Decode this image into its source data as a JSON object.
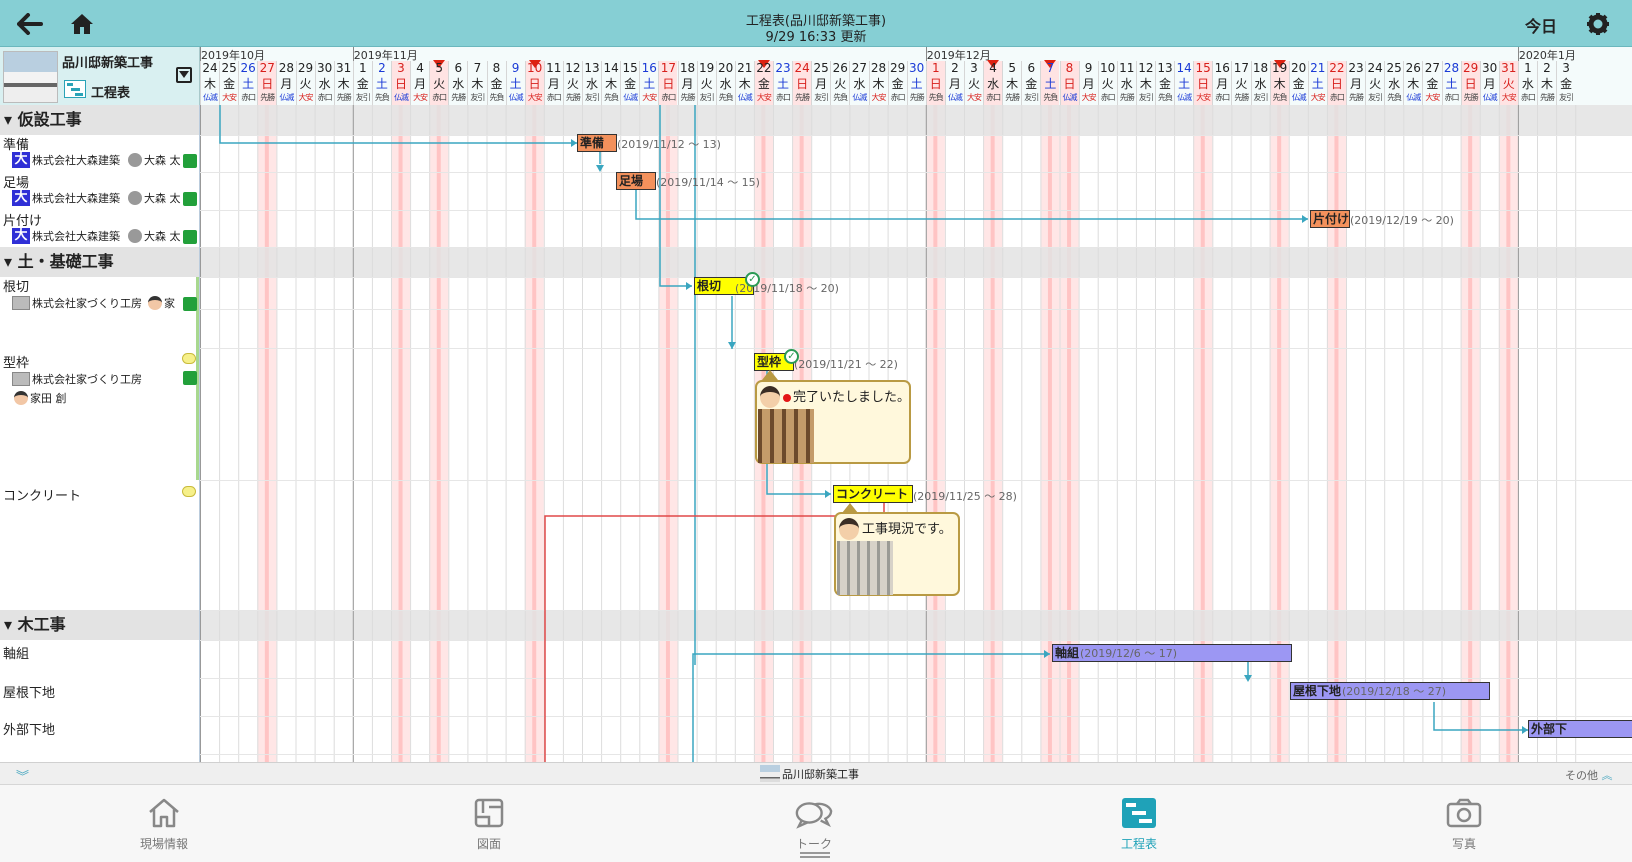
{
  "header": {
    "title": "工程表(品川邸新築工事)",
    "updated": "9/29 16:33 更新",
    "today_label": "今日"
  },
  "project": {
    "name": "品川邸新築工事",
    "sub_label": "工程表"
  },
  "months": [
    {
      "label": "2019年10月",
      "start": 0
    },
    {
      "label": "2019年11月",
      "start": 8
    },
    {
      "label": "2019年12月",
      "start": 38
    },
    {
      "label": "2020年1月",
      "start": 69
    }
  ],
  "days": [
    {
      "d": "24",
      "w": "木",
      "r": "仏滅",
      "c": "k"
    },
    {
      "d": "25",
      "w": "金",
      "r": "大安",
      "c": "k"
    },
    {
      "d": "26",
      "w": "土",
      "r": "赤口",
      "c": "b"
    },
    {
      "d": "27",
      "w": "日",
      "r": "先勝",
      "c": "r"
    },
    {
      "d": "28",
      "w": "月",
      "r": "仏滅",
      "c": "k"
    },
    {
      "d": "29",
      "w": "火",
      "r": "大安",
      "c": "k"
    },
    {
      "d": "30",
      "w": "水",
      "r": "赤口",
      "c": "k"
    },
    {
      "d": "31",
      "w": "木",
      "r": "先勝",
      "c": "k"
    },
    {
      "d": "1",
      "w": "金",
      "r": "友引",
      "c": "k"
    },
    {
      "d": "2",
      "w": "土",
      "r": "先負",
      "c": "b"
    },
    {
      "d": "3",
      "w": "日",
      "r": "仏滅",
      "c": "r"
    },
    {
      "d": "4",
      "w": "月",
      "r": "大安",
      "c": "k"
    },
    {
      "d": "5",
      "w": "火",
      "r": "赤口",
      "c": "k",
      "h": true
    },
    {
      "d": "6",
      "w": "水",
      "r": "先勝",
      "c": "k"
    },
    {
      "d": "7",
      "w": "木",
      "r": "友引",
      "c": "k"
    },
    {
      "d": "8",
      "w": "金",
      "r": "先負",
      "c": "k"
    },
    {
      "d": "9",
      "w": "土",
      "r": "仏滅",
      "c": "b"
    },
    {
      "d": "10",
      "w": "日",
      "r": "大安",
      "c": "r",
      "h": true
    },
    {
      "d": "11",
      "w": "月",
      "r": "赤口",
      "c": "k"
    },
    {
      "d": "12",
      "w": "火",
      "r": "先勝",
      "c": "k"
    },
    {
      "d": "13",
      "w": "水",
      "r": "友引",
      "c": "k"
    },
    {
      "d": "14",
      "w": "木",
      "r": "先負",
      "c": "k"
    },
    {
      "d": "15",
      "w": "金",
      "r": "仏滅",
      "c": "k"
    },
    {
      "d": "16",
      "w": "土",
      "r": "大安",
      "c": "b"
    },
    {
      "d": "17",
      "w": "日",
      "r": "赤口",
      "c": "r"
    },
    {
      "d": "18",
      "w": "月",
      "r": "先勝",
      "c": "k"
    },
    {
      "d": "19",
      "w": "火",
      "r": "友引",
      "c": "k"
    },
    {
      "d": "20",
      "w": "水",
      "r": "先負",
      "c": "k"
    },
    {
      "d": "21",
      "w": "木",
      "r": "仏滅",
      "c": "k"
    },
    {
      "d": "22",
      "w": "金",
      "r": "大安",
      "c": "k",
      "h": true
    },
    {
      "d": "23",
      "w": "土",
      "r": "赤口",
      "c": "b"
    },
    {
      "d": "24",
      "w": "日",
      "r": "先勝",
      "c": "r"
    },
    {
      "d": "25",
      "w": "月",
      "r": "友引",
      "c": "k"
    },
    {
      "d": "26",
      "w": "火",
      "r": "先負",
      "c": "k"
    },
    {
      "d": "27",
      "w": "水",
      "r": "仏滅",
      "c": "k"
    },
    {
      "d": "28",
      "w": "木",
      "r": "大安",
      "c": "k"
    },
    {
      "d": "29",
      "w": "金",
      "r": "赤口",
      "c": "k"
    },
    {
      "d": "30",
      "w": "土",
      "r": "先勝",
      "c": "b"
    },
    {
      "d": "1",
      "w": "日",
      "r": "先負",
      "c": "r"
    },
    {
      "d": "2",
      "w": "月",
      "r": "仏滅",
      "c": "k"
    },
    {
      "d": "3",
      "w": "火",
      "r": "大安",
      "c": "k"
    },
    {
      "d": "4",
      "w": "水",
      "r": "赤口",
      "c": "k",
      "h": true
    },
    {
      "d": "5",
      "w": "木",
      "r": "先勝",
      "c": "k"
    },
    {
      "d": "6",
      "w": "金",
      "r": "友引",
      "c": "k"
    },
    {
      "d": "7",
      "w": "土",
      "r": "先負",
      "c": "b",
      "h": true
    },
    {
      "d": "8",
      "w": "日",
      "r": "仏滅",
      "c": "r"
    },
    {
      "d": "9",
      "w": "月",
      "r": "大安",
      "c": "k"
    },
    {
      "d": "10",
      "w": "火",
      "r": "赤口",
      "c": "k"
    },
    {
      "d": "11",
      "w": "水",
      "r": "先勝",
      "c": "k"
    },
    {
      "d": "12",
      "w": "木",
      "r": "友引",
      "c": "k"
    },
    {
      "d": "13",
      "w": "金",
      "r": "先負",
      "c": "k"
    },
    {
      "d": "14",
      "w": "土",
      "r": "仏滅",
      "c": "b"
    },
    {
      "d": "15",
      "w": "日",
      "r": "大安",
      "c": "r"
    },
    {
      "d": "16",
      "w": "月",
      "r": "赤口",
      "c": "k"
    },
    {
      "d": "17",
      "w": "火",
      "r": "先勝",
      "c": "k"
    },
    {
      "d": "18",
      "w": "水",
      "r": "友引",
      "c": "k"
    },
    {
      "d": "19",
      "w": "木",
      "r": "先負",
      "c": "k",
      "h": true
    },
    {
      "d": "20",
      "w": "金",
      "r": "仏滅",
      "c": "k"
    },
    {
      "d": "21",
      "w": "土",
      "r": "大安",
      "c": "b"
    },
    {
      "d": "22",
      "w": "日",
      "r": "赤口",
      "c": "r"
    },
    {
      "d": "23",
      "w": "月",
      "r": "先勝",
      "c": "k"
    },
    {
      "d": "24",
      "w": "火",
      "r": "友引",
      "c": "k"
    },
    {
      "d": "25",
      "w": "水",
      "r": "先負",
      "c": "k"
    },
    {
      "d": "26",
      "w": "木",
      "r": "仏滅",
      "c": "k"
    },
    {
      "d": "27",
      "w": "金",
      "r": "大安",
      "c": "k"
    },
    {
      "d": "28",
      "w": "土",
      "r": "赤口",
      "c": "b"
    },
    {
      "d": "29",
      "w": "日",
      "r": "先勝",
      "c": "r"
    },
    {
      "d": "30",
      "w": "月",
      "r": "仏滅",
      "c": "k"
    },
    {
      "d": "31",
      "w": "火",
      "r": "大安",
      "c": "r"
    },
    {
      "d": "1",
      "w": "水",
      "r": "赤口",
      "c": "k"
    },
    {
      "d": "2",
      "w": "木",
      "r": "先勝",
      "c": "k"
    },
    {
      "d": "3",
      "w": "金",
      "r": "友引",
      "c": "k"
    }
  ],
  "groups": [
    {
      "label": "仮設工事"
    },
    {
      "label": "土・基礎工事"
    },
    {
      "label": "木工事"
    }
  ],
  "tasks": {
    "junbi": {
      "name": "準備",
      "company": "株式会社大森建築",
      "person": "大森 太",
      "bar": "準備",
      "range": "(2019/11/12 ～ 13)"
    },
    "ashiba": {
      "name": "足場",
      "company": "株式会社大森建築",
      "person": "大森 太",
      "bar": "足場",
      "range": "(2019/11/14 ～ 15)"
    },
    "katazuke": {
      "name": "片付け",
      "company": "株式会社大森建築",
      "person": "大森 太",
      "bar": "片付け",
      "range": "(2019/12/19 ～ 20)"
    },
    "negiri": {
      "name": "根切",
      "company": "株式会社家づくり工房",
      "person": "家",
      "bar": "根切",
      "range": "(2019/11/18 ～ 20)"
    },
    "katawaku": {
      "name": "型枠",
      "company": "株式会社家づくり工房",
      "person": "家田 創",
      "bar": "型枠",
      "range": "(2019/11/21 ～ 22)",
      "comment": "完了いたしました。"
    },
    "concrete": {
      "name": "コンクリート",
      "bar": "コンクリート",
      "range": "(2019/11/25 ～ 28)",
      "comment": "工事現況です。"
    },
    "jikugumi": {
      "name": "軸組",
      "bar": "軸組",
      "range": "(2019/12/6 ～ 17)"
    },
    "yanesita": {
      "name": "屋根下地",
      "bar": "屋根下地",
      "range": "(2019/12/18 ～ 27)"
    },
    "gaibu": {
      "name": "外部下地",
      "bar": "外部下"
    }
  },
  "bottom": {
    "project_name": "品川邸新築工事",
    "other_label": "その他"
  },
  "tabs": [
    {
      "label": "現場情報",
      "icon": "home-icon"
    },
    {
      "label": "図面",
      "icon": "drawing-icon"
    },
    {
      "label": "トーク",
      "icon": "chat-icon"
    },
    {
      "label": "工程表",
      "icon": "schedule-icon",
      "active": true
    },
    {
      "label": "写真",
      "icon": "camera-icon"
    }
  ],
  "colors": {
    "header_bg": "#86cfd4",
    "accent": "#1fa2b8",
    "bar_orange": "#f3915c",
    "bar_yellow": "#ffff00",
    "bar_purple": "#9c97f3",
    "link_line": "#3aa6c0",
    "critical_line": "#e04848"
  }
}
